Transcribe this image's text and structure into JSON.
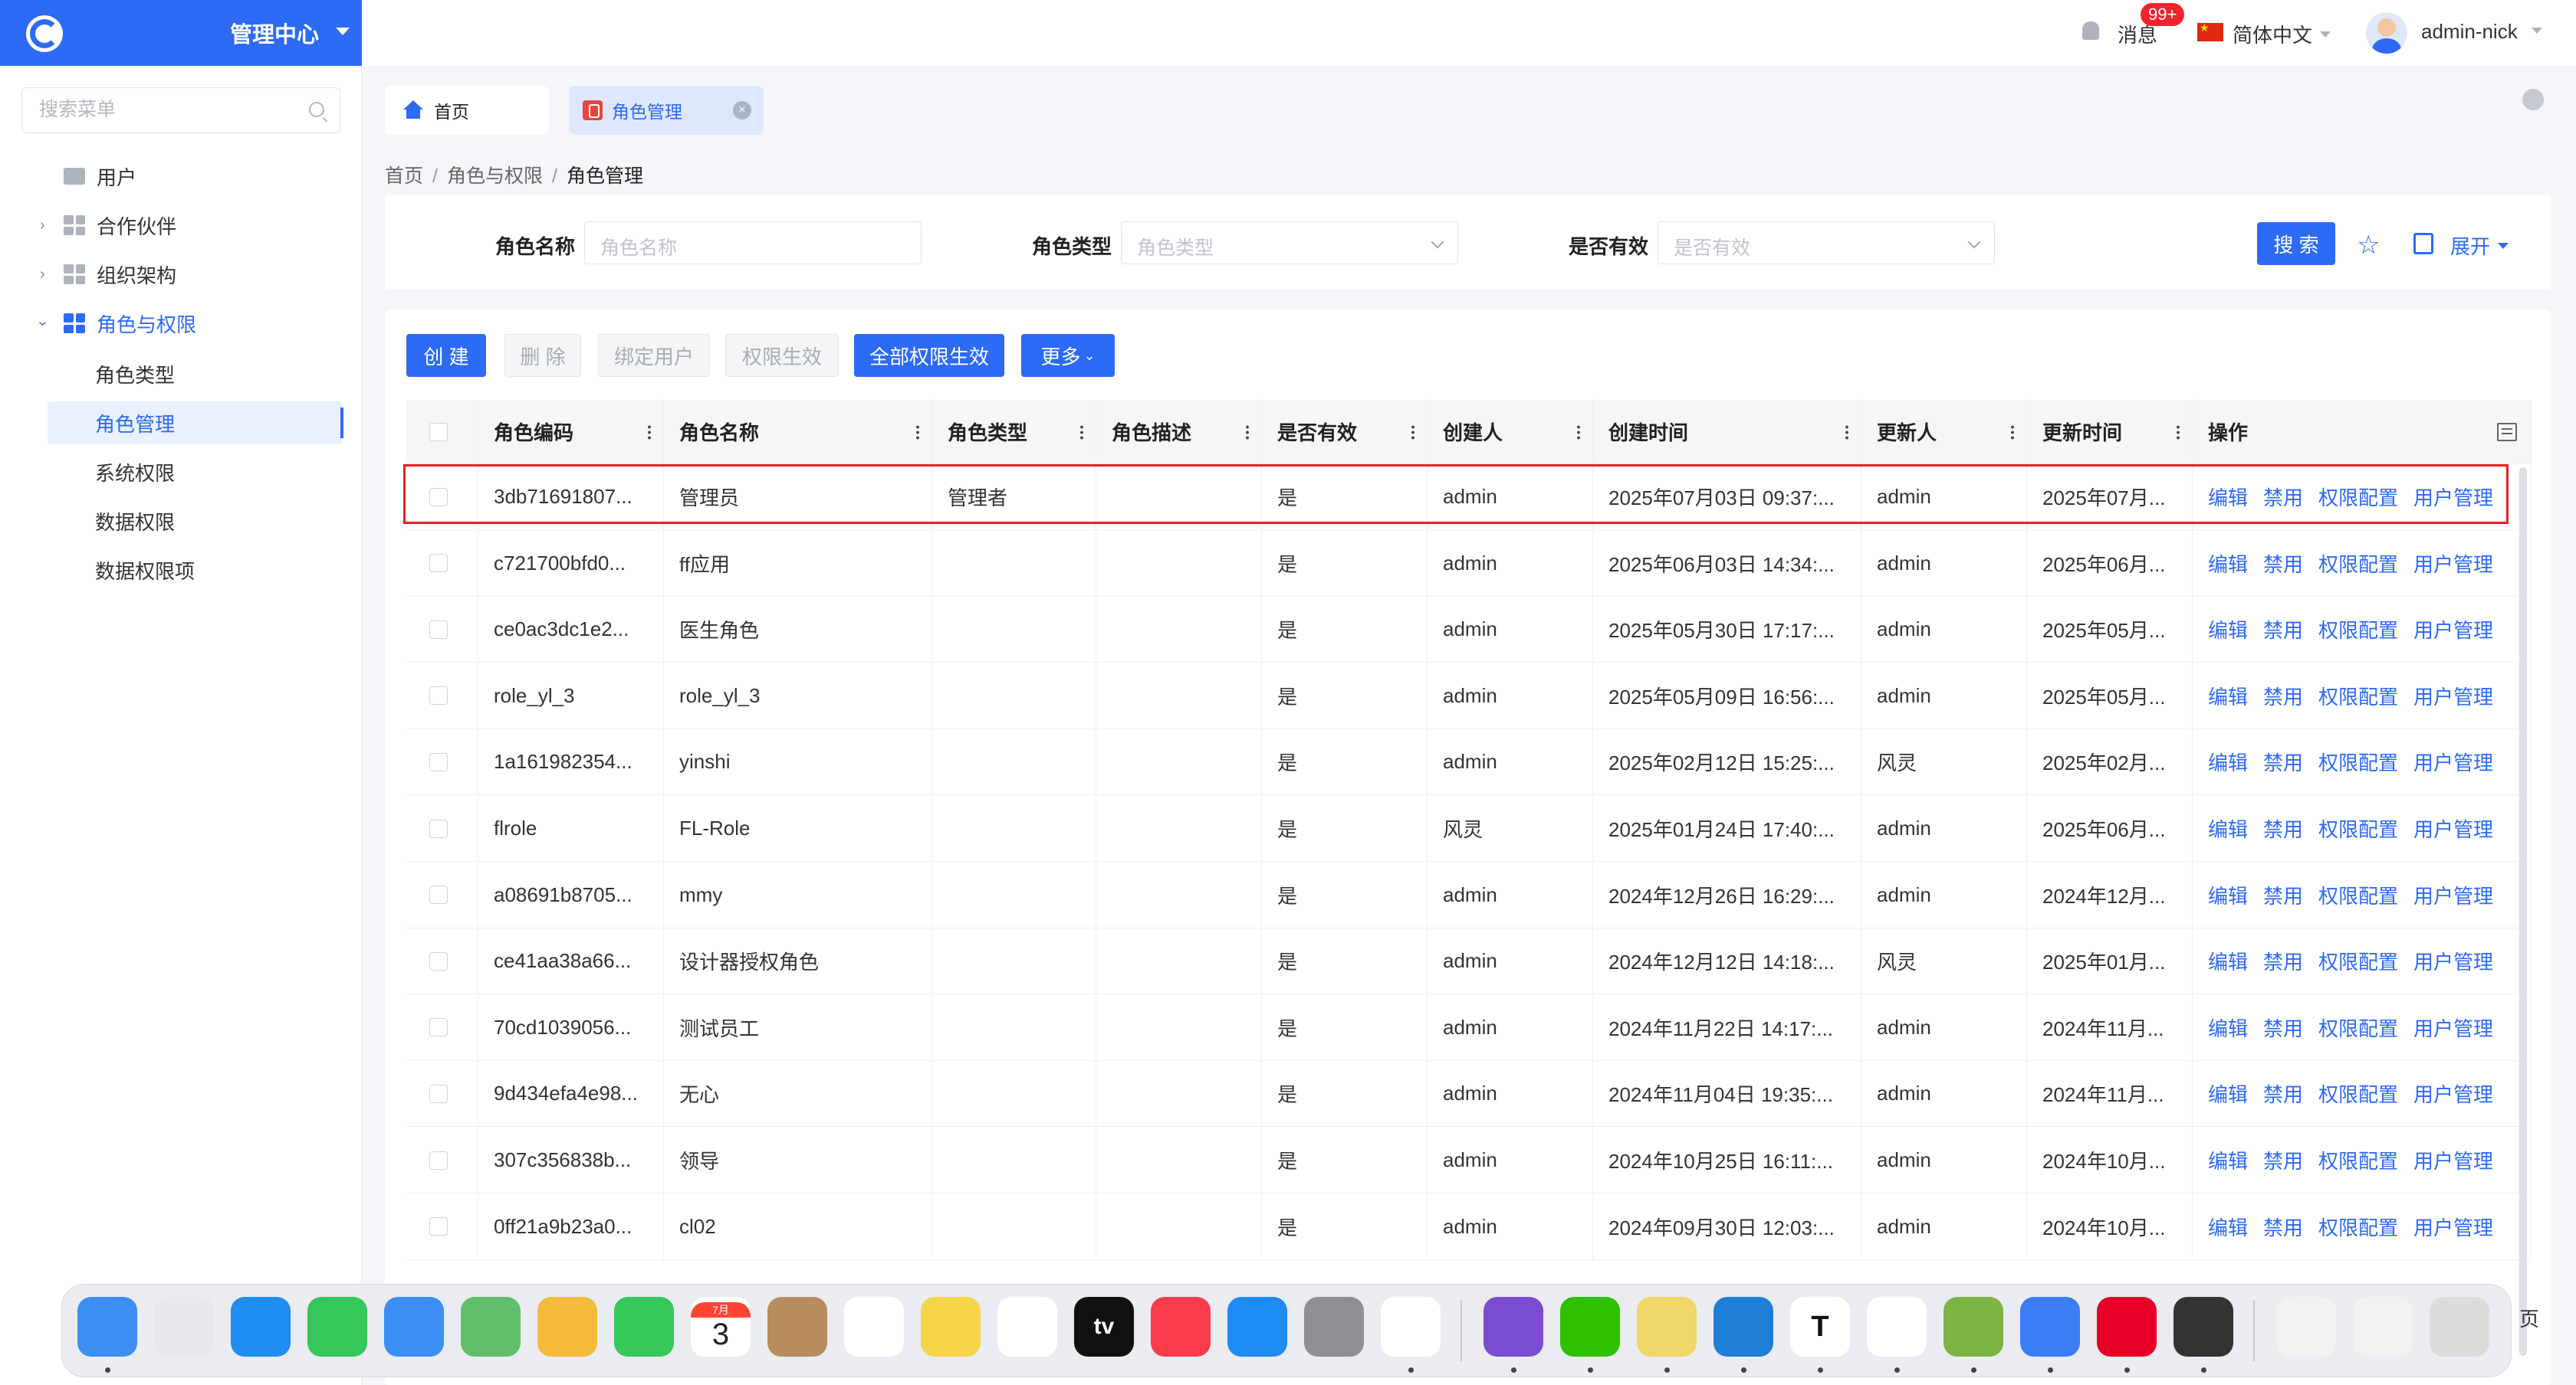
{
  "app": {
    "title": "管理中心"
  },
  "sidebar": {
    "search_placeholder": "搜索菜单",
    "items": [
      {
        "label": "用户"
      },
      {
        "label": "合作伙伴"
      },
      {
        "label": "组织架构"
      },
      {
        "label": "角色与权限"
      }
    ],
    "sub_items": [
      {
        "label": "角色类型"
      },
      {
        "label": "角色管理"
      },
      {
        "label": "系统权限"
      },
      {
        "label": "数据权限"
      },
      {
        "label": "数据权限项"
      }
    ]
  },
  "topbar": {
    "messages": "消息",
    "badge": "99+",
    "language": "简体中文",
    "username": "admin-nick"
  },
  "tabs": [
    {
      "label": "首页"
    },
    {
      "label": "角色管理"
    }
  ],
  "breadcrumb": [
    "首页",
    "角色与权限",
    "角色管理"
  ],
  "filter": {
    "name_label": "角色名称",
    "name_placeholder": "角色名称",
    "type_label": "角色类型",
    "type_placeholder": "角色类型",
    "valid_label": "是否有效",
    "valid_placeholder": "是否有效",
    "search": "搜 索",
    "expand": "展开"
  },
  "toolbar": {
    "create": "创 建",
    "delete": "删 除",
    "bind_user": "绑定用户",
    "perm_apply": "权限生效",
    "all_perm_apply": "全部权限生效",
    "more": "更多"
  },
  "table": {
    "headers": [
      "角色编码",
      "角色名称",
      "角色类型",
      "角色描述",
      "是否有效",
      "创建人",
      "创建时间",
      "更新人",
      "更新时间",
      "操作"
    ],
    "actions": [
      "编辑",
      "禁用",
      "权限配置",
      "用户管理"
    ],
    "rows": [
      [
        "3db71691807...",
        "管理员",
        "管理者",
        "",
        "是",
        "admin",
        "2025年07月03日 09:37:...",
        "admin",
        "2025年07月..."
      ],
      [
        "c721700bfd0...",
        "ff应用",
        "",
        "",
        "是",
        "admin",
        "2025年06月03日 14:34:...",
        "admin",
        "2025年06月..."
      ],
      [
        "ce0ac3dc1e2...",
        "医生角色",
        "",
        "",
        "是",
        "admin",
        "2025年05月30日 17:17:...",
        "admin",
        "2025年05月..."
      ],
      [
        "role_yl_3",
        "role_yl_3",
        "",
        "",
        "是",
        "admin",
        "2025年05月09日 16:56:...",
        "admin",
        "2025年05月..."
      ],
      [
        "1a161982354...",
        "yinshi",
        "",
        "",
        "是",
        "admin",
        "2025年02月12日 15:25:...",
        "风灵",
        "2025年02月..."
      ],
      [
        "flrole",
        "FL-Role",
        "",
        "",
        "是",
        "风灵",
        "2025年01月24日 17:40:...",
        "admin",
        "2025年06月..."
      ],
      [
        "a08691b8705...",
        "mmy",
        "",
        "",
        "是",
        "admin",
        "2024年12月26日 16:29:...",
        "admin",
        "2024年12月..."
      ],
      [
        "ce41aa38a66...",
        "设计器授权角色",
        "",
        "",
        "是",
        "admin",
        "2024年12月12日 14:18:...",
        "风灵",
        "2025年01月..."
      ],
      [
        "70cd1039056...",
        "测试员工",
        "",
        "",
        "是",
        "admin",
        "2024年11月22日 14:17:...",
        "admin",
        "2024年11月..."
      ],
      [
        "9d434efa4e98...",
        "无心",
        "",
        "",
        "是",
        "admin",
        "2024年11月04日 19:35:...",
        "admin",
        "2024年11月..."
      ],
      [
        "307c356838b...",
        "领导",
        "",
        "",
        "是",
        "admin",
        "2024年10月25日 16:11:...",
        "admin",
        "2024年10月..."
      ],
      [
        "0ff21a9b23a0...",
        "cl02",
        "",
        "",
        "是",
        "admin",
        "2024年09月30日 12:03:...",
        "admin",
        "2024年10月..."
      ]
    ]
  },
  "dock": {
    "calendar_month": "7月",
    "calendar_day": "3",
    "tv_label": "tv",
    "typora_label": "T",
    "page_label": "页",
    "apps": [
      {
        "name": "finder-icon",
        "color": "#3d8ef5"
      },
      {
        "name": "launchpad-icon",
        "color": "#e8e8ec"
      },
      {
        "name": "safari-icon",
        "color": "#1e8ef0"
      },
      {
        "name": "messages-icon",
        "color": "#35c759"
      },
      {
        "name": "mail-icon",
        "color": "#3b8ff5"
      },
      {
        "name": "maps-icon",
        "color": "#5fbf6a"
      },
      {
        "name": "photos-icon",
        "color": "#f6b93b"
      },
      {
        "name": "facetime-icon",
        "color": "#34c759"
      },
      {
        "name": "calendar-icon",
        "color": "#ffffff"
      },
      {
        "name": "contacts-icon",
        "color": "#b98c5e"
      },
      {
        "name": "reminders-icon",
        "color": "#ffffff"
      },
      {
        "name": "notes-icon",
        "color": "#f7d54a"
      },
      {
        "name": "freeform-icon",
        "color": "#ffffff"
      },
      {
        "name": "apple-tv-icon",
        "color": "#111111"
      },
      {
        "name": "music-icon",
        "color": "#fa3c4c"
      },
      {
        "name": "app-store-icon",
        "color": "#1d8bf2"
      },
      {
        "name": "system-settings-icon",
        "color": "#8e8e93"
      },
      {
        "name": "chrome-icon",
        "color": "#ffffff"
      },
      {
        "name": "github-desktop-icon",
        "color": "#7b4bd1"
      },
      {
        "name": "wechat-icon",
        "color": "#2dc100"
      },
      {
        "name": "stickies-icon",
        "color": "#f1d66a"
      },
      {
        "name": "vscode-icon",
        "color": "#1f7fd6"
      },
      {
        "name": "typora-icon",
        "color": "#ffffff"
      },
      {
        "name": "qq-icon",
        "color": "#ffffff"
      },
      {
        "name": "cloud-app-icon",
        "color": "#7cb342"
      },
      {
        "name": "feishu-icon",
        "color": "#3b7df7"
      },
      {
        "name": "netease-music-icon",
        "color": "#e60026"
      },
      {
        "name": "craft-icon",
        "color": "#333333"
      },
      {
        "name": "document-icon",
        "color": "#f2f2f2"
      },
      {
        "name": "screenshot-icon",
        "color": "#f2f2f2"
      },
      {
        "name": "trash-icon",
        "color": "#dcdcdc"
      }
    ]
  },
  "colors": {
    "primary": "#2d6af6",
    "selected_row_border": "#e02424",
    "badge": "#f5222d"
  }
}
